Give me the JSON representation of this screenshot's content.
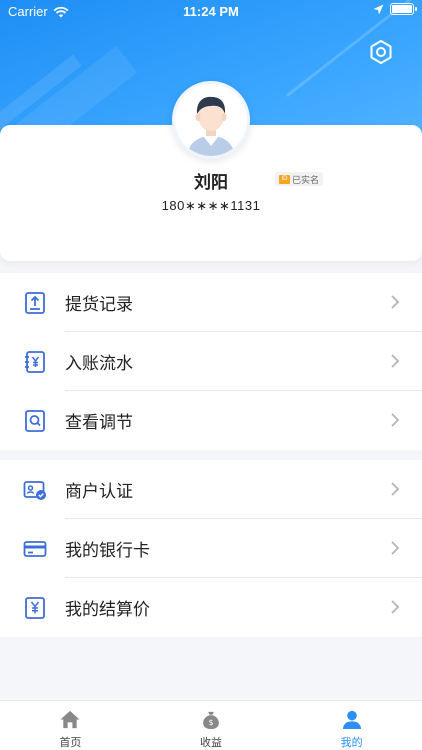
{
  "status_bar": {
    "carrier": "Carrier",
    "time": "11:24 PM"
  },
  "profile": {
    "name": "刘阳",
    "verified_label": "已实名",
    "phone": "180∗∗∗∗1131"
  },
  "menu_groups": [
    {
      "items": [
        {
          "label": "提货记录",
          "icon": "receipt-upload-icon"
        },
        {
          "label": "入账流水",
          "icon": "yuan-ledger-icon"
        },
        {
          "label": "查看调节",
          "icon": "magnify-doc-icon"
        }
      ]
    },
    {
      "items": [
        {
          "label": "商户认证",
          "icon": "merchant-cert-icon"
        },
        {
          "label": "我的银行卡",
          "icon": "bank-card-icon"
        },
        {
          "label": "我的结算价",
          "icon": "yuan-doc-icon"
        }
      ]
    }
  ],
  "tab_bar": {
    "tabs": [
      {
        "label": "首页",
        "icon": "home-icon",
        "active": false
      },
      {
        "label": "收益",
        "icon": "money-bag-icon",
        "active": false
      },
      {
        "label": "我的",
        "icon": "person-icon",
        "active": true
      }
    ]
  },
  "colors": {
    "accent": "#2b8ff5",
    "header_gradient_start": "#1e8ef5",
    "header_gradient_end": "#5cb8ff",
    "icon_blue": "#3d6fd6",
    "inactive_icon": "#888888"
  }
}
